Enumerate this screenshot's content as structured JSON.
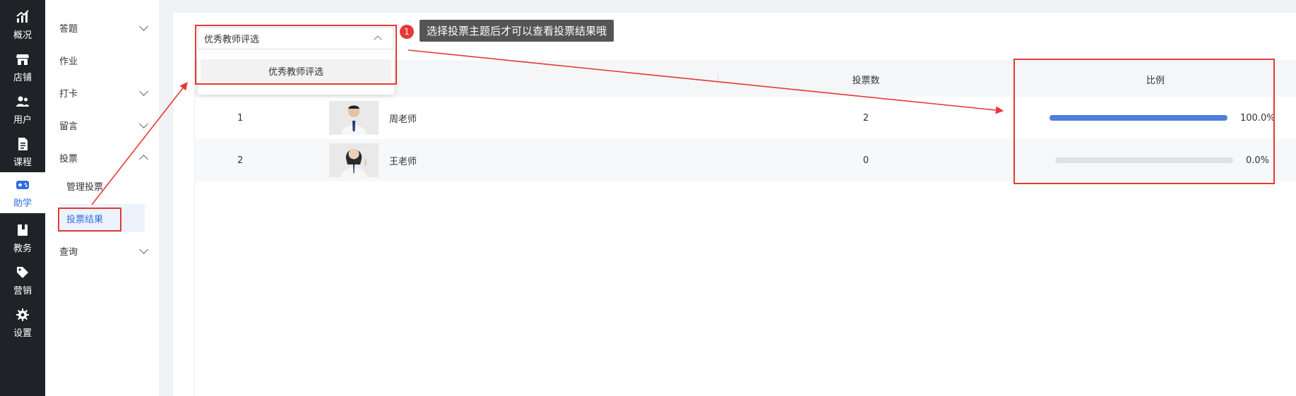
{
  "rail": [
    {
      "label": "概况",
      "icon": "overview-icon"
    },
    {
      "label": "店铺",
      "icon": "store-icon"
    },
    {
      "label": "用户",
      "icon": "users-icon"
    },
    {
      "label": "课程",
      "icon": "course-icon"
    },
    {
      "label": "助学",
      "icon": "gamepad-icon",
      "active": true
    },
    {
      "label": "教务",
      "icon": "book-icon"
    },
    {
      "label": "营销",
      "icon": "tag-icon"
    },
    {
      "label": "设置",
      "icon": "gear-icon"
    }
  ],
  "submenu": {
    "items": [
      "答题",
      "作业",
      "打卡",
      "留言",
      "投票",
      "管理投票",
      "投票结果",
      "查询"
    ]
  },
  "select": {
    "value": "优秀教师评选",
    "options": [
      "优秀教师评选"
    ]
  },
  "annotation": {
    "badge": "1",
    "tip": "选择投票主题后才可以查看投票结果哦",
    "accent": "#e53935"
  },
  "table": {
    "columns": [
      "投票数",
      "比例"
    ],
    "rows": [
      {
        "rank": "1",
        "name": "周老师",
        "votes": "2",
        "ratio_text": "100.0%",
        "ratio": 1.0
      },
      {
        "rank": "2",
        "name": "王老师",
        "votes": "0",
        "ratio_text": "0.0%",
        "ratio": 0.0
      }
    ],
    "bar_color": "#4d7fdb"
  }
}
